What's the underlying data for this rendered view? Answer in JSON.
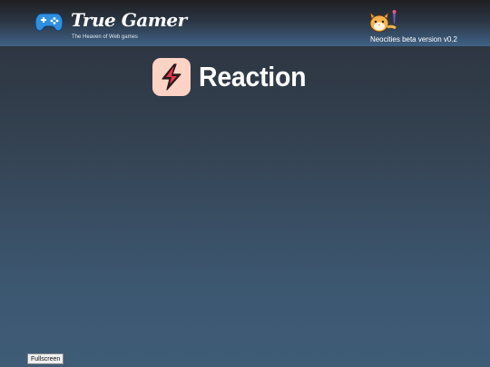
{
  "header": {
    "site_title": "True Gamer",
    "tagline": "The Heaven of Web games",
    "logo_icon": "gamepad-icon",
    "mascot_icon": "cat-mascot-icon",
    "version_label": "Neocities beta version v0.2"
  },
  "game": {
    "title": "Reaction",
    "icon": "lightning-bolt-icon",
    "icon_bg_color": "#fcd3c4"
  },
  "controls": {
    "fullscreen_label": "Fullscreen"
  },
  "colors": {
    "header_accent": "#3f6286",
    "logo_blue": "#2f8fe0",
    "background_bottom": "#3f5c77"
  }
}
